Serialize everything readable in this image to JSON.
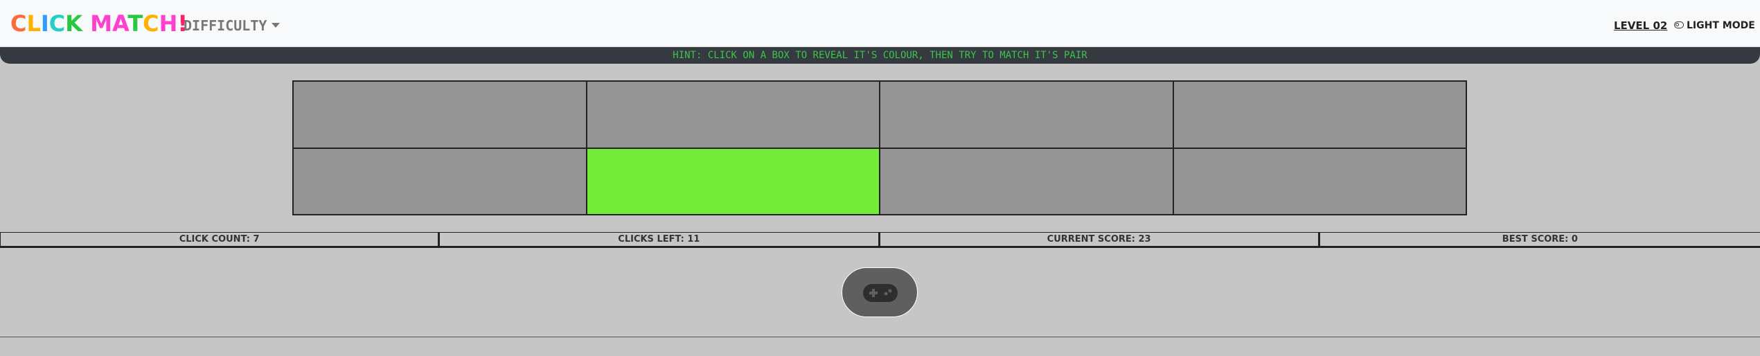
{
  "navbar": {
    "brand_letters": [
      {
        "char": "C",
        "color": "#ff6a3d"
      },
      {
        "char": "L",
        "color": "#ffb000"
      },
      {
        "char": "I",
        "color": "#2f9bff"
      },
      {
        "char": "C",
        "color": "#23d1c4"
      },
      {
        "char": "K",
        "color": "#28c840"
      },
      {
        "char": " ",
        "color": "#000000"
      },
      {
        "char": "M",
        "color": "#ff3fd0"
      },
      {
        "char": "A",
        "color": "#ff3fd0"
      },
      {
        "char": "T",
        "color": "#28c840"
      },
      {
        "char": "C",
        "color": "#ffb000"
      },
      {
        "char": "H",
        "color": "#ff3fd0"
      },
      {
        "char": "!",
        "color": "#ff1f6b"
      }
    ],
    "difficulty_label": "DIFFICULTY",
    "level_label": "LEVEL 02",
    "mode_label": "LIGHT MODE"
  },
  "hint": "HINT: CLICK ON A BOX TO REVEAL IT'S COLOUR, THEN TRY TO MATCH IT'S PAIR",
  "grid": {
    "rows": 2,
    "cols": 4,
    "hidden_color": "#959595",
    "tiles": [
      {
        "revealed": false
      },
      {
        "revealed": false
      },
      {
        "revealed": false
      },
      {
        "revealed": false
      },
      {
        "revealed": false
      },
      {
        "revealed": true,
        "color": "#72eb39"
      },
      {
        "revealed": false
      },
      {
        "revealed": false
      }
    ]
  },
  "stats": {
    "click_count": "CLICK COUNT: 7",
    "clicks_left": "CLICKS LEFT: 11",
    "current_score": "CURRENT SCORE: 23",
    "best_score": "BEST SCORE: 0"
  },
  "game_button": {
    "icon": "gamepad-icon"
  },
  "colors": {
    "background": "#c6c6c6",
    "hint_bar": "#343a40",
    "hint_text": "#3ec34e",
    "button": "#5f5f5f"
  }
}
